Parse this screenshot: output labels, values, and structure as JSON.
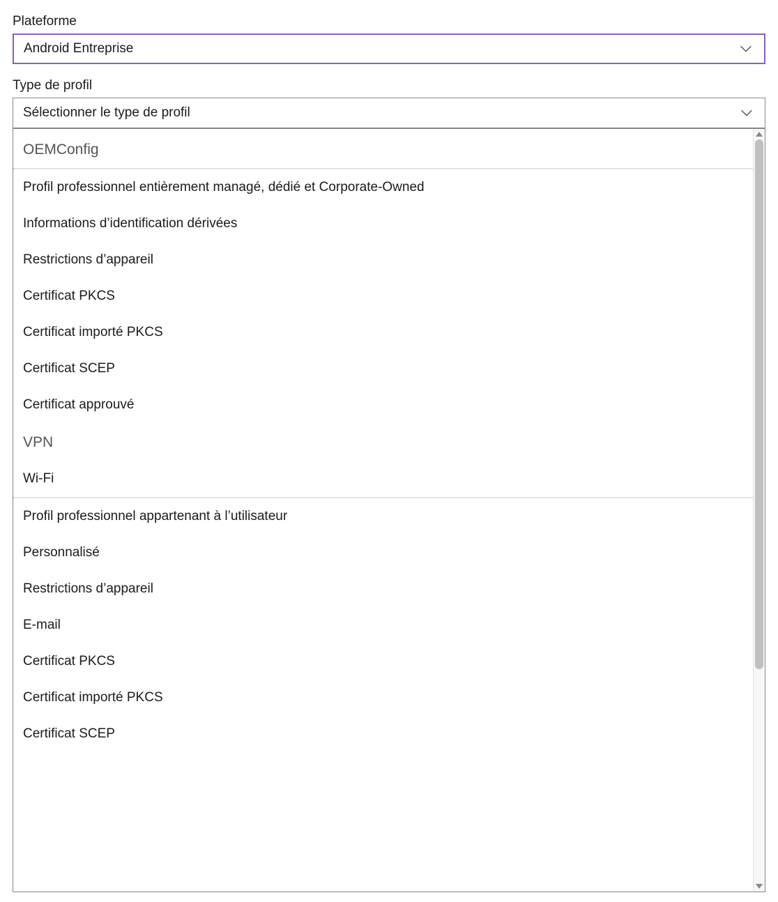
{
  "platform": {
    "label": "Plateforme",
    "value": "Android Entreprise"
  },
  "profile_type": {
    "label": "Type de profil",
    "placeholder": "Sélectionner le type de profil",
    "options": [
      {
        "type": "group",
        "label": "OEMConfig"
      },
      {
        "type": "group_header_item",
        "label": "Profil professionnel entièrement managé, dédié et Corporate-Owned",
        "divider_before": true
      },
      {
        "type": "item",
        "label": "Informations d’identification dérivées"
      },
      {
        "type": "item",
        "label": "Restrictions d’appareil"
      },
      {
        "type": "item",
        "label": "Certificat PKCS"
      },
      {
        "type": "item",
        "label": "Certificat importé PKCS"
      },
      {
        "type": "item",
        "label": "Certificat SCEP"
      },
      {
        "type": "item",
        "label": "Certificat approuvé"
      },
      {
        "type": "group",
        "label": "VPN"
      },
      {
        "type": "item",
        "label": "Wi-Fi"
      },
      {
        "type": "group_header_item",
        "label": "Profil professionnel appartenant à l’utilisateur",
        "divider_before": true
      },
      {
        "type": "item",
        "label": "Personnalisé"
      },
      {
        "type": "item",
        "label": "Restrictions d’appareil"
      },
      {
        "type": "item",
        "label": "E-mail"
      },
      {
        "type": "item",
        "label": "Certificat PKCS"
      },
      {
        "type": "item",
        "label": "Certificat importé PKCS"
      },
      {
        "type": "item",
        "label": "Certificat SCEP"
      }
    ]
  }
}
